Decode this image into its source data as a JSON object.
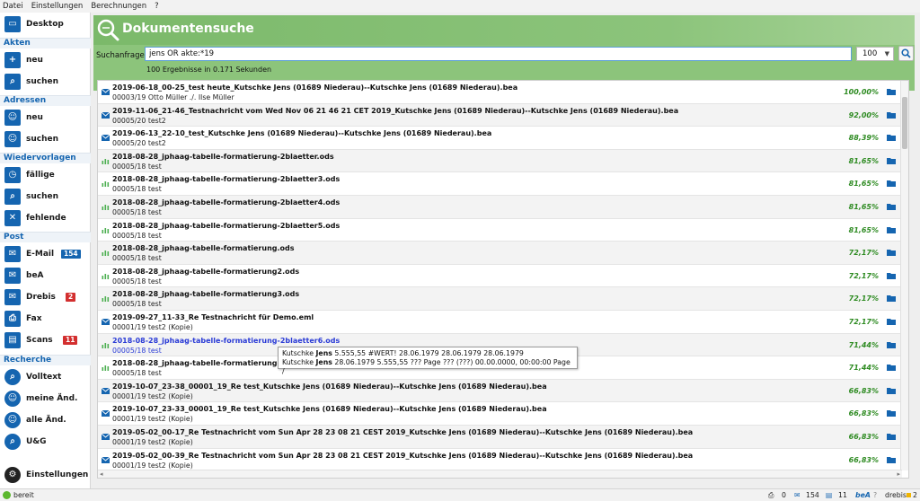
{
  "menu": [
    "Datei",
    "Einstellungen",
    "Berechnungen",
    "?"
  ],
  "sidebar": {
    "desktop": "Desktop",
    "sections": {
      "akten": "Akten",
      "adressen": "Adressen",
      "wiedervorlagen": "Wiedervorlagen",
      "post": "Post",
      "recherche": "Recherche"
    },
    "akten_neu": "neu",
    "akten_suchen": "suchen",
    "adressen_neu": "neu",
    "adressen_suchen": "suchen",
    "wv_faellige": "fällige",
    "wv_suchen": "suchen",
    "wv_fehlende": "fehlende",
    "post_email": "E-Mail",
    "post_email_badge": "154",
    "post_bea": "beA",
    "post_drebis": "Drebis",
    "post_drebis_badge": "2",
    "post_fax": "Fax",
    "post_scans": "Scans",
    "post_scans_badge": "11",
    "rech_volltext": "Volltext",
    "rech_meine": "meine Änd.",
    "rech_alle": "alle Änd.",
    "rech_ug": "U&G",
    "settings": "Einstellungen"
  },
  "header": {
    "title": "Dokumentensuche"
  },
  "query": {
    "label": "Suchanfrage:",
    "value": "jens OR akte:*19",
    "count": "100",
    "info": "100 Ergebnisse in 0.171 Sekunden"
  },
  "results": [
    {
      "type": "mail",
      "title": "2019-06-18_00-25_test heute_Kutschke Jens (01689 Niederau)--Kutschke Jens (01689 Niederau).bea",
      "sub": "00003/19 Otto Müller ./. Ilse Müller",
      "score": "100,00%"
    },
    {
      "type": "mail",
      "title": "2019-11-06_21-46_Testnachricht vom Wed Nov 06 21 46 21 CET 2019_Kutschke Jens (01689 Niederau)--Kutschke Jens (01689 Niederau).bea",
      "sub": "00005/20 test2",
      "score": "92,00%"
    },
    {
      "type": "mail",
      "title": "2019-06-13_22-10_test_Kutschke Jens (01689 Niederau)--Kutschke Jens (01689 Niederau).bea",
      "sub": "00005/20 test2",
      "score": "88,39%"
    },
    {
      "type": "sheet",
      "title": "2018-08-28_jphaag-tabelle-formatierung-2blaetter.ods",
      "sub": "00005/18 test",
      "score": "81,65%"
    },
    {
      "type": "sheet",
      "title": "2018-08-28_jphaag-tabelle-formatierung-2blaetter3.ods",
      "sub": "00005/18 test",
      "score": "81,65%"
    },
    {
      "type": "sheet",
      "title": "2018-08-28_jphaag-tabelle-formatierung-2blaetter4.ods",
      "sub": "00005/18 test",
      "score": "81,65%"
    },
    {
      "type": "sheet",
      "title": "2018-08-28_jphaag-tabelle-formatierung-2blaetter5.ods",
      "sub": "00005/18 test",
      "score": "81,65%"
    },
    {
      "type": "sheet",
      "title": "2018-08-28_jphaag-tabelle-formatierung.ods",
      "sub": "00005/18 test",
      "score": "72,17%"
    },
    {
      "type": "sheet",
      "title": "2018-08-28_jphaag-tabelle-formatierung2.ods",
      "sub": "00005/18 test",
      "score": "72,17%"
    },
    {
      "type": "sheet",
      "title": "2018-08-28_jphaag-tabelle-formatierung3.ods",
      "sub": "00005/18 test",
      "score": "72,17%"
    },
    {
      "type": "mail",
      "title": "2019-09-27_11-33_Re Testnachricht für Demo.eml",
      "sub": "00001/19 test2 (Kopie)",
      "score": "72,17%"
    },
    {
      "type": "sheet",
      "title": "2018-08-28_jphaag-tabelle-formatierung-2blaetter6.ods",
      "sub": "00005/18 test",
      "score": "71,44%",
      "selected": true
    },
    {
      "type": "sheet",
      "title": "2018-08-28_jphaag-tabelle-formatierung-2b",
      "sub": "00005/18 test",
      "score": "71,44%"
    },
    {
      "type": "mail",
      "title": "2019-10-07_23-38_00001_19_Re test_Kutschke Jens (01689 Niederau)--Kutschke Jens (01689 Niederau).bea",
      "sub": "00001/19 test2 (Kopie)",
      "score": "66,83%"
    },
    {
      "type": "mail",
      "title": "2019-10-07_23-33_00001_19_Re test_Kutschke Jens (01689 Niederau)--Kutschke Jens (01689 Niederau).bea",
      "sub": "00001/19 test2 (Kopie)",
      "score": "66,83%"
    },
    {
      "type": "mail",
      "title": "2019-05-02_00-17_Re Testnachricht vom Sun Apr 28 23 08 21 CEST 2019_Kutschke Jens (01689 Niederau)--Kutschke Jens (01689 Niederau).bea",
      "sub": "00001/19 test2 (Kopie)",
      "score": "66,83%"
    },
    {
      "type": "mail",
      "title": "2019-05-02_00-39_Re Testnachricht vom Sun Apr 28 23 08 21 CEST 2019_Kutschke Jens (01689 Niederau)--Kutschke Jens (01689 Niederau).bea",
      "sub": "00001/19 test2 (Kopie)",
      "score": "66,83%"
    }
  ],
  "tooltip": {
    "line1_pre": "Kutschke ",
    "line1_bold": "Jens",
    "line1_post": " 5.555,55 #WERT! 28.06.1979 28.06.1979 28.06.1979",
    "line2_pre": "Kutschke ",
    "line2_bold": "Jens",
    "line2_post": " 28.06.1979 5.555,55 ??? Page ??? (???) 00.00.0000, 00:00:00 Page /"
  },
  "status": {
    "text": "bereit",
    "printer_count": "0",
    "mail_count": "154",
    "scan_count": "11",
    "bea_label": "beA",
    "bea_q": "?",
    "drebis_label": "drebis",
    "drebis_count": "2"
  },
  "colors": {
    "accent": "#1565b0",
    "header_green": "#8cc47b",
    "score_green": "#2e8b22",
    "selected": "#2a3bd6"
  }
}
